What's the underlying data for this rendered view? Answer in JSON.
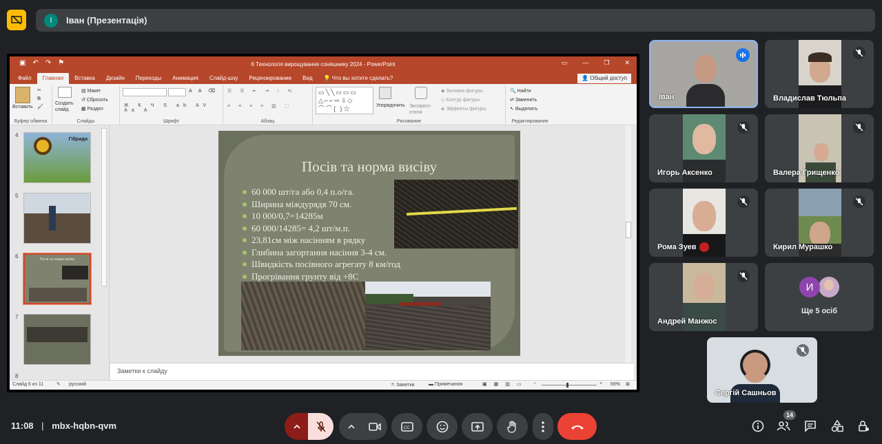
{
  "topbar": {
    "presenter_initial": "I",
    "presenter_title": "Іван (Презентація)"
  },
  "ppt": {
    "window_title": "6 Технологія вирощування соняшнику 2024 - PowerPoint",
    "tabs": [
      "Файл",
      "Главная",
      "Вставка",
      "Дизайн",
      "Переходы",
      "Анимация",
      "Слайд-шоу",
      "Рецензирование",
      "Вид"
    ],
    "active_tab": "Главная",
    "help_text": "Что вы хотите сделать?",
    "share_label": "Общий доступ",
    "ribbon": {
      "paste": "Вставить",
      "clipboard_group": "Буфер обмена",
      "new_slide": "Создать слайд",
      "layout": "Макет",
      "reset": "Сбросить",
      "section": "Раздел",
      "slides_group": "Слайды",
      "font_group": "Шрифт",
      "paragraph_group": "Абзац",
      "arrange": "Упорядочить",
      "quick_styles": "Экспресс-стили",
      "shape_fill": "Заливка фигуры",
      "shape_outline": "Контур фигуры",
      "shape_effects": "Эффекты фигуры",
      "drawing_group": "Рисование",
      "find": "Найти",
      "replace": "Заменить",
      "select": "Выделить",
      "editing_group": "Редактирование"
    },
    "thumbnails": [
      {
        "num": "4",
        "caption": "Гібриди"
      },
      {
        "num": "5",
        "caption": ""
      },
      {
        "num": "6",
        "caption": "Посів та норма висіву"
      },
      {
        "num": "7",
        "caption": ""
      },
      {
        "num": "8",
        "caption": ""
      }
    ],
    "slide": {
      "title": "Посів та норма висіву",
      "bullets": [
        "60 000 шт/га або 0,4 п.о/га.",
        "Ширина міждурядя 70 см.",
        "10 000/0,7=14285м",
        "60 000/14285= 4,2 шт/м.п.",
        "23,81см між насінням в рядку",
        "Глибина загортання насіння 3-4 см.",
        "Швидкість посівного агрегату  8 км/год",
        "Прогрівання грунту від +8С"
      ]
    },
    "notes_placeholder": "Заметки к слайду",
    "status": {
      "slide_count": "Слайд 6 из 11",
      "language": "русский",
      "notes": "Заметки",
      "comments": "Примечания",
      "zoom": "69%"
    }
  },
  "participants": [
    {
      "name": "Іван"
    },
    {
      "name": "Владислав Тюльпа"
    },
    {
      "name": "Игорь Аксенко"
    },
    {
      "name": "Валера Грищенко"
    },
    {
      "name": "Рома Зуев"
    },
    {
      "name": "Кирил Мурашко"
    },
    {
      "name": "Андрей Манжос"
    }
  ],
  "more_tile": {
    "initial": "И",
    "label": "Ще 5 осіб"
  },
  "self_view": {
    "name": "Сергій Сашньов"
  },
  "bottom": {
    "time": "11:08",
    "separator": "|",
    "meeting_code": "mbx-hqbn-qvm",
    "participant_count": "14"
  },
  "colors": {
    "end_call": "#ea4335",
    "mic_off": "#f9dedc",
    "present_badge": "#fbbc04",
    "ppt_accent": "#b7472a"
  }
}
